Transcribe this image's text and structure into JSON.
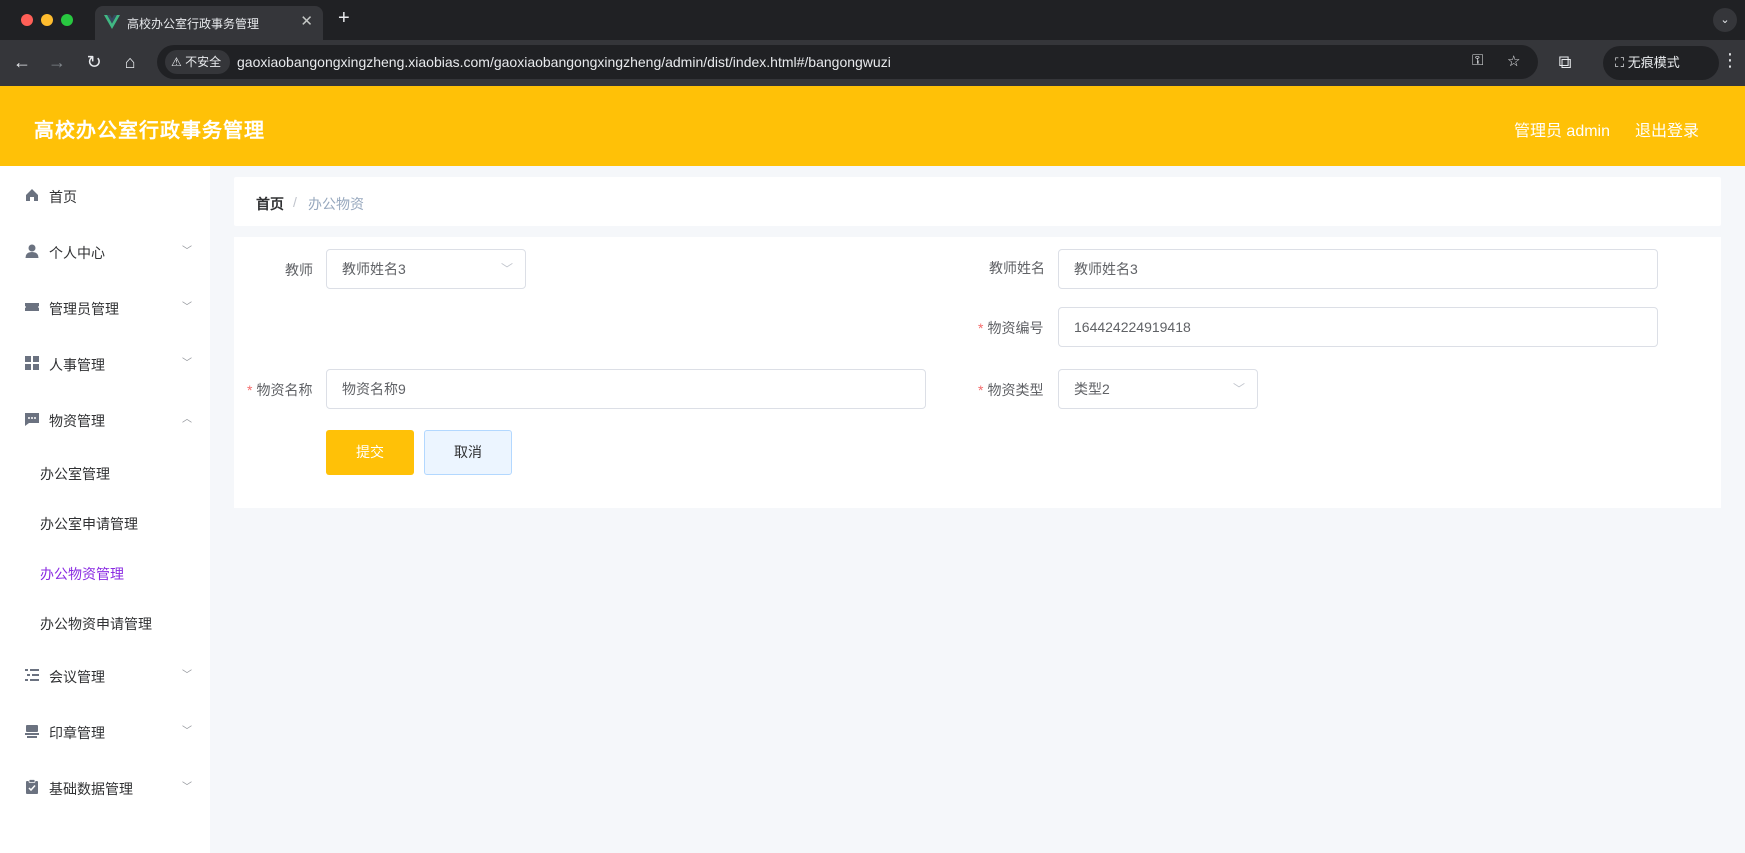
{
  "browser": {
    "tab_title": "高校办公室行政事务管理",
    "insecure_label": "不安全",
    "url": "gaoxiaobangongxingzheng.xiaobias.com/gaoxiaobangongxingzheng/admin/dist/index.html#/bangongwuzi",
    "incognito_label": "无痕模式"
  },
  "header": {
    "title": "高校办公室行政事务管理",
    "user": "管理员 admin",
    "logout": "退出登录",
    "bg_color": "#ffc107"
  },
  "sidebar": {
    "items": [
      {
        "label": "首页",
        "icon": "home-icon"
      },
      {
        "label": "个人中心",
        "icon": "user-icon"
      },
      {
        "label": "管理员管理",
        "icon": "ticket-icon"
      },
      {
        "label": "人事管理",
        "icon": "grid-icon"
      },
      {
        "label": "物资管理",
        "icon": "message-icon"
      },
      {
        "label": "会议管理",
        "icon": "list-icon"
      },
      {
        "label": "印章管理",
        "icon": "stamp-icon"
      },
      {
        "label": "基础数据管理",
        "icon": "clipboard-icon"
      }
    ],
    "sub_items": [
      "办公室管理",
      "办公室申请管理",
      "办公物资管理",
      "办公物资申请管理"
    ],
    "active_sub_item": "办公物资管理",
    "active_color": "#8a2be2"
  },
  "breadcrumb": {
    "home": "首页",
    "separator": "/",
    "current": "办公物资"
  },
  "form": {
    "teacher_label": "教师",
    "teacher_value": "教师姓名3",
    "teacher_name_label": "教师姓名",
    "teacher_name_value": "教师姓名3",
    "code_label": "物资编号",
    "code_value": "164424224919418",
    "name_label": "物资名称",
    "name_value": "物资名称9",
    "type_label": "物资类型",
    "type_value": "类型2",
    "required_mark": "*",
    "submit": "提交",
    "cancel": "取消"
  }
}
